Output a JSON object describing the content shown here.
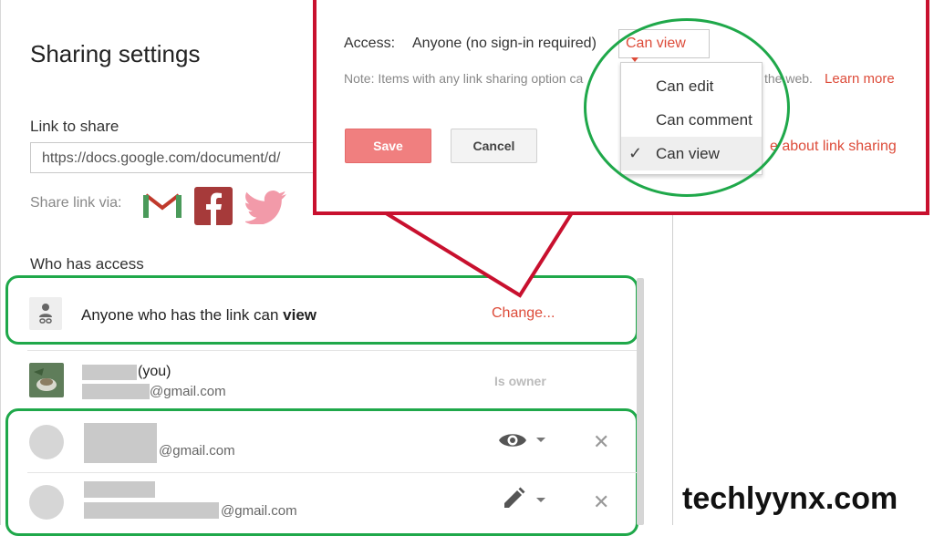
{
  "dialog": {
    "title": "Sharing settings",
    "link_label": "Link to share",
    "link_value": "https://docs.google.com/document/d/",
    "share_via_label": "Share link via:",
    "who_label": "Who has access"
  },
  "access_rows": [
    {
      "text_prefix": "Anyone who has the link can ",
      "text_bold": "view",
      "action": "Change..."
    },
    {
      "name_suffix": "(you)",
      "email_suffix": "@gmail.com",
      "role": "Is owner"
    },
    {
      "email_suffix": "@gmail.com",
      "permission_icon": "eye-icon"
    },
    {
      "email_suffix": "@gmail.com",
      "permission_icon": "pencil-icon"
    }
  ],
  "popup": {
    "access_label": "Access:",
    "access_value": "Anyone (no sign-in required)",
    "dropdown_value": "Can view",
    "note": "Note: Items with any link sharing option ca",
    "note_tail": "the web.",
    "learn_more": "Learn more",
    "link_sharing": "e about link sharing",
    "save_label": "Save",
    "cancel_label": "Cancel",
    "menu": [
      "Can edit",
      "Can comment",
      "Can view"
    ],
    "menu_selected": "Can view"
  },
  "brand": "techlyynx.com",
  "colors": {
    "accent_red": "#dd4b39",
    "callout_red": "#c8102e",
    "highlight_green": "#1fa84a"
  }
}
